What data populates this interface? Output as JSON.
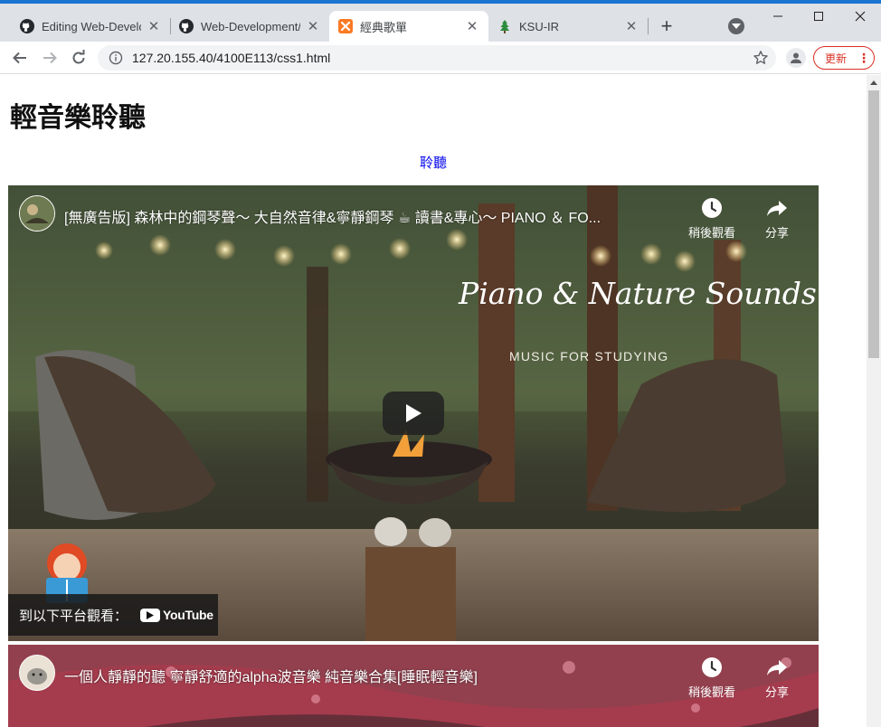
{
  "browser": {
    "tabs": [
      {
        "title": "Editing Web-Develo",
        "icon": "github-icon"
      },
      {
        "title": "Web-Development/",
        "icon": "github-icon"
      },
      {
        "title": "經典歌單",
        "icon": "xampp-icon",
        "active": true
      },
      {
        "title": "KSU-IR",
        "icon": "tree-icon"
      }
    ],
    "url": "127.20.155.40/4100E113/css1.html",
    "update_label": "更新"
  },
  "page": {
    "heading": "輕音樂聆聽",
    "link_label": "聆聽"
  },
  "videos": [
    {
      "title": "[無廣告版] 森林中的鋼琴聲～ 大自然音律&寧靜鋼琴 ☕ 讀書&專心～ PIANO ＆ FO...",
      "watch_later": "稍後觀看",
      "share": "分享",
      "watch_on": "到以下平台觀看：",
      "youtube": "YouTube",
      "overlay_title": "Piano & Nature Sounds",
      "overlay_subtitle": "MUSIC FOR STUDYING"
    },
    {
      "title": "一個人靜靜的聽 寧靜舒適的alpha波音樂 純音樂合集[睡眠輕音樂]",
      "watch_later": "稍後觀看",
      "share": "分享"
    }
  ]
}
